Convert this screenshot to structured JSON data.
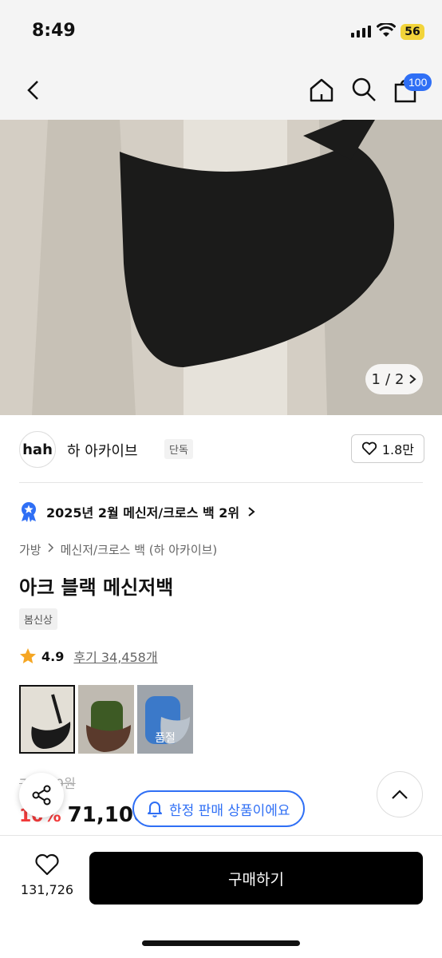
{
  "status": {
    "time": "8:49",
    "battery": "56"
  },
  "nav": {
    "cart_count": "100",
    "icons": [
      "back-icon",
      "home-icon",
      "search-icon",
      "cart-icon"
    ]
  },
  "hero": {
    "page_current": "1",
    "page_sep": "/",
    "page_total": "2"
  },
  "brand": {
    "logo_text": "hah",
    "name": "하 아카이브",
    "tag": "단독",
    "likes": "1.8만"
  },
  "rank": {
    "text": "2025년 2월 메신저/크로스 백 2위"
  },
  "breadcrumb": {
    "level1": "가방",
    "level2": "메신저/크로스 백 (하 아카이브)"
  },
  "product": {
    "title": "아크 블랙 메신저백",
    "badge": "봄신상",
    "rating": "4.9",
    "review": "후기 34,458개",
    "soldout": "품절",
    "orig_price": "79,000원",
    "discount": "10%",
    "price": "71,100원"
  },
  "overlay": {
    "limited_label": "한정 판매 상품이에요"
  },
  "footer": {
    "wish_count": "131,726",
    "buy_label": "구매하기"
  },
  "colors": {
    "accent": "#2f6ff5",
    "sale": "#f23b3b"
  }
}
